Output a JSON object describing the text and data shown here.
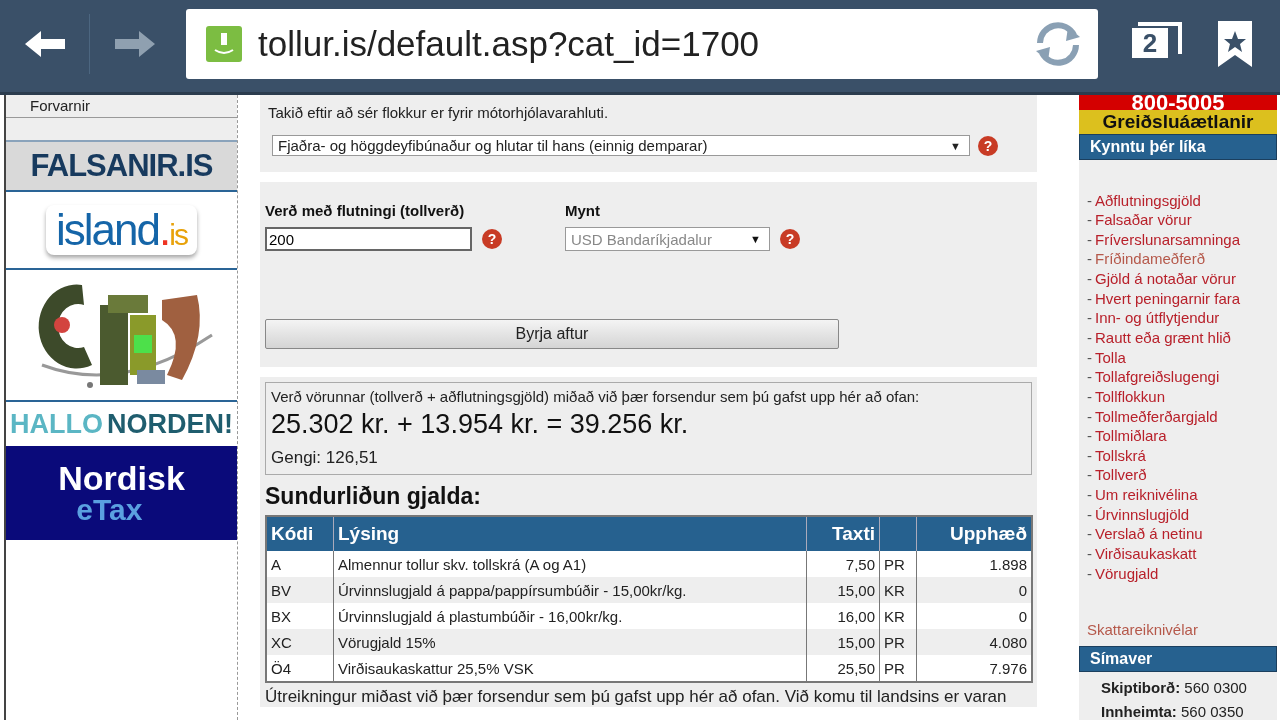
{
  "browser": {
    "url": "tollur.is/default.asp?cat_id=1700",
    "tab_count": "2",
    "back_enabled": true,
    "forward_enabled": false
  },
  "left_sidebar": {
    "menu_items": [
      "Forvarnir"
    ],
    "banners": [
      {
        "kind": "falsanir",
        "text": "FALSANIR.IS"
      },
      {
        "kind": "island",
        "text": "island",
        "dot": ".",
        "suffix": "is"
      },
      {
        "kind": "picture"
      },
      {
        "kind": "hallo",
        "text": "HALLO",
        "text2": "NORDEN!"
      },
      {
        "kind": "etax",
        "text": "Nordisk",
        "text2": "eTax"
      }
    ]
  },
  "category": {
    "hint": "Takið eftir að sér flokkur er fyrir mótorhjólavarahluti.",
    "select_value": "Fjaðra- og höggdeyfibúnaður og hlutar til hans (einnig demparar)",
    "select_arrow": "▼",
    "help": "?"
  },
  "form": {
    "price_label": "Verð með flutningi (tollverð)",
    "price_value": "200",
    "price_help": "?",
    "currency_label": "Mynt",
    "currency_value": "USD Bandaríkjadalur",
    "currency_arrow": "▼",
    "currency_help": "?",
    "currency_disabled": true,
    "reset_button": "Byrja aftur"
  },
  "result": {
    "intro": "Verð vörunnar (tollverð + aðflutningsgjöld) miðað við þær forsendur sem þú gafst upp hér að ofan:",
    "total": "25.302 kr. + 13.954 kr. = 39.256 kr.",
    "rate": "Gengi: 126,51"
  },
  "breakdown": {
    "title": "Sundurliðun gjalda:",
    "columns": [
      "Kódi",
      "Lýsing",
      "Taxti",
      "",
      "Upphæð"
    ],
    "rows": [
      [
        "A",
        "Almennur tollur skv. tollskrá (A og A1)",
        "7,50",
        "PR",
        "1.898"
      ],
      [
        "BV",
        "Úrvinnslugjald á pappa/pappírsumbúðir - 15,00kr/kg.",
        "15,00",
        "KR",
        "0"
      ],
      [
        "BX",
        "Úrvinnslugjald á plastumbúðir - 16,00kr/kg.",
        "16,00",
        "KR",
        "0"
      ],
      [
        "XC",
        "Vörugjald 15%",
        "15,00",
        "PR",
        "4.080"
      ],
      [
        "Ö4",
        "Virðisaukaskattur 25,5% VSK",
        "25,50",
        "PR",
        "7.976"
      ]
    ]
  },
  "footnote": "Útreikningur miðast við þær forsendur sem þú gafst upp hér að ofan. Við komu til landsins er varan",
  "right_sidebar": {
    "phone_banner": "800-5005",
    "payment_banner": "Greiðsluáætlanir",
    "links_title": "Kynntu þér líka",
    "link_prefix": "-",
    "links": [
      {
        "label": "Aðflutningsgjöld",
        "visited": false
      },
      {
        "label": "Falsaðar vörur",
        "visited": false
      },
      {
        "label": "Fríverslunarsamninga",
        "visited": false
      },
      {
        "label": "Fríðindameðferð",
        "visited": true
      },
      {
        "label": "Gjöld á notaðar vörur",
        "visited": false
      },
      {
        "label": "Hvert peningarnir fara",
        "visited": false
      },
      {
        "label": "Inn- og útflytjendur",
        "visited": false
      },
      {
        "label": "Rautt eða grænt hlið",
        "visited": false
      },
      {
        "label": "Tolla",
        "visited": false
      },
      {
        "label": "Tollafgreiðslugengi",
        "visited": false
      },
      {
        "label": "Tollflokkun",
        "visited": false
      },
      {
        "label": "Tollmeðferðargjald",
        "visited": false
      },
      {
        "label": "Tollmiðlara",
        "visited": false
      },
      {
        "label": "Tollskrá",
        "visited": false
      },
      {
        "label": "Tollverð",
        "visited": false
      },
      {
        "label": "Um reiknivélina",
        "visited": false
      },
      {
        "label": "Úrvinnslugjöld",
        "visited": false
      },
      {
        "label": "Verslað á netinu",
        "visited": false
      },
      {
        "label": "Virðisaukaskatt",
        "visited": false
      },
      {
        "label": "Vörugjald",
        "visited": false
      }
    ],
    "calculators_link": "Skattareiknivélar",
    "phone_title": "Símaver",
    "phones": [
      {
        "label": "Skiptiborð:",
        "number": "560 0300"
      },
      {
        "label": "Innheimta:",
        "number": "560 0350"
      }
    ]
  }
}
